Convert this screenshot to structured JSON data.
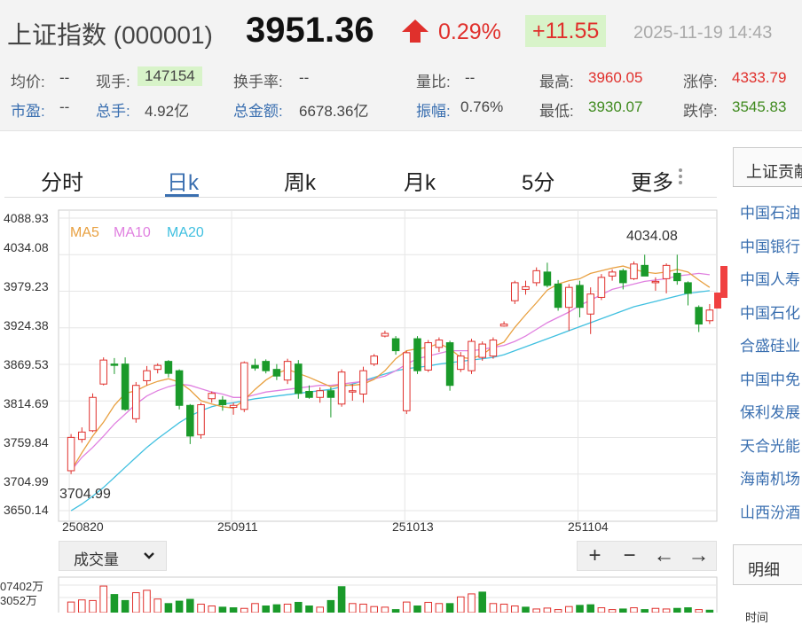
{
  "header": {
    "title": "上证指数 (000001)",
    "price": "3951.36",
    "change_pct": "0.29%",
    "change_abs": "+11.55",
    "datetime": "2025-11-19 14:43",
    "stats": [
      {
        "label": "均价:",
        "value": "--",
        "color": "plain"
      },
      {
        "label": "现手:",
        "value": "147154",
        "color": "hl"
      },
      {
        "label": "换手率:",
        "value": "--",
        "color": "plain"
      },
      {
        "label": "量比:",
        "value": "--",
        "color": "plain"
      },
      {
        "label": "最高:",
        "value": "3960.05",
        "color": "red"
      },
      {
        "label": "涨停:",
        "value": "4333.79",
        "color": "red"
      },
      {
        "label": "市盈:",
        "value": "--",
        "color": "plain"
      },
      {
        "label": "总手:",
        "value": "4.92亿",
        "color": "plain"
      },
      {
        "label": "总金额:",
        "value": "6678.36亿",
        "color": "plain"
      },
      {
        "label": "振幅:",
        "value": "0.76%",
        "color": "plain"
      },
      {
        "label": "最低:",
        "value": "3930.07",
        "color": "green"
      },
      {
        "label": "跌停:",
        "value": "3545.83",
        "color": "green"
      }
    ],
    "colors": {
      "up": "#e0302c",
      "down": "#1a9a2a",
      "accent": "#3a6fb0"
    }
  },
  "tabs": [
    "分时",
    "日k",
    "周k",
    "月k",
    "5分",
    "更多"
  ],
  "active_tab": "日k",
  "chart": {
    "y_ticks": [
      "4088.93",
      "4034.08",
      "3979.23",
      "3924.38",
      "3869.53",
      "3814.69",
      "3759.84",
      "3704.99",
      "3650.14"
    ],
    "x_ticks": [
      "250820",
      "250911",
      "251013",
      "251104"
    ],
    "ma_labels": [
      {
        "name": "MA5",
        "color": "#e8a040"
      },
      {
        "name": "MA10",
        "color": "#e080e0"
      },
      {
        "name": "MA20",
        "color": "#40c0e0"
      }
    ],
    "high_label": "4034.08",
    "low_label": "3704.99"
  },
  "chart_data": {
    "type": "candlestick",
    "ylim": [
      3650.14,
      4088.93
    ],
    "y_ticks": [
      4088.93,
      4034.08,
      3979.23,
      3924.38,
      3869.53,
      3814.69,
      3759.84,
      3704.99,
      3650.14
    ],
    "x_ticks": [
      "250820",
      "250911",
      "251013",
      "251104"
    ],
    "series_names": [
      "MA5",
      "MA10",
      "MA20"
    ],
    "candles": [
      {
        "o": 3710,
        "h": 3765,
        "l": 3705,
        "c": 3760
      },
      {
        "o": 3757,
        "h": 3775,
        "l": 3752,
        "c": 3768
      },
      {
        "o": 3770,
        "h": 3826,
        "l": 3768,
        "c": 3820
      },
      {
        "o": 3840,
        "h": 3880,
        "l": 3838,
        "c": 3876
      },
      {
        "o": 3870,
        "h": 3879,
        "l": 3855,
        "c": 3868
      },
      {
        "o": 3870,
        "h": 3880,
        "l": 3800,
        "c": 3802
      },
      {
        "o": 3788,
        "h": 3843,
        "l": 3782,
        "c": 3838
      },
      {
        "o": 3845,
        "h": 3867,
        "l": 3838,
        "c": 3860
      },
      {
        "o": 3862,
        "h": 3871,
        "l": 3856,
        "c": 3868
      },
      {
        "o": 3874,
        "h": 3876,
        "l": 3850,
        "c": 3856
      },
      {
        "o": 3860,
        "h": 3862,
        "l": 3802,
        "c": 3808
      },
      {
        "o": 3808,
        "h": 3810,
        "l": 3750,
        "c": 3762
      },
      {
        "o": 3764,
        "h": 3812,
        "l": 3758,
        "c": 3809
      },
      {
        "o": 3818,
        "h": 3829,
        "l": 3812,
        "c": 3826
      },
      {
        "o": 3816,
        "h": 3822,
        "l": 3800,
        "c": 3809
      },
      {
        "o": 3805,
        "h": 3812,
        "l": 3794,
        "c": 3808
      },
      {
        "o": 3802,
        "h": 3874,
        "l": 3798,
        "c": 3872
      },
      {
        "o": 3868,
        "h": 3878,
        "l": 3860,
        "c": 3864
      },
      {
        "o": 3874,
        "h": 3877,
        "l": 3856,
        "c": 3860
      },
      {
        "o": 3862,
        "h": 3870,
        "l": 3846,
        "c": 3852
      },
      {
        "o": 3846,
        "h": 3878,
        "l": 3840,
        "c": 3874
      },
      {
        "o": 3870,
        "h": 3876,
        "l": 3818,
        "c": 3826
      },
      {
        "o": 3829,
        "h": 3838,
        "l": 3818,
        "c": 3820
      },
      {
        "o": 3820,
        "h": 3835,
        "l": 3812,
        "c": 3830
      },
      {
        "o": 3830,
        "h": 3835,
        "l": 3790,
        "c": 3820
      },
      {
        "o": 3810,
        "h": 3862,
        "l": 3806,
        "c": 3858
      },
      {
        "o": 3828,
        "h": 3840,
        "l": 3815,
        "c": 3830
      },
      {
        "o": 3825,
        "h": 3866,
        "l": 3812,
        "c": 3860
      },
      {
        "o": 3870,
        "h": 3885,
        "l": 3867,
        "c": 3882
      },
      {
        "o": 3912,
        "h": 3920,
        "l": 3910,
        "c": 3916
      },
      {
        "o": 3908,
        "h": 3912,
        "l": 3884,
        "c": 3890
      },
      {
        "o": 3800,
        "h": 3890,
        "l": 3795,
        "c": 3887
      },
      {
        "o": 3908,
        "h": 3912,
        "l": 3855,
        "c": 3860
      },
      {
        "o": 3861,
        "h": 3906,
        "l": 3858,
        "c": 3902
      },
      {
        "o": 3895,
        "h": 3910,
        "l": 3888,
        "c": 3906
      },
      {
        "o": 3902,
        "h": 3905,
        "l": 3830,
        "c": 3838
      },
      {
        "o": 3862,
        "h": 3888,
        "l": 3858,
        "c": 3882
      },
      {
        "o": 3860,
        "h": 3908,
        "l": 3855,
        "c": 3904
      },
      {
        "o": 3880,
        "h": 3904,
        "l": 3875,
        "c": 3900
      },
      {
        "o": 3882,
        "h": 3910,
        "l": 3878,
        "c": 3906
      },
      {
        "o": 3927,
        "h": 3934,
        "l": 3926,
        "c": 3930
      },
      {
        "o": 3965,
        "h": 3995,
        "l": 3960,
        "c": 3992
      },
      {
        "o": 3982,
        "h": 3995,
        "l": 3974,
        "c": 3986
      },
      {
        "o": 3992,
        "h": 4015,
        "l": 3987,
        "c": 4010
      },
      {
        "o": 4008,
        "h": 4022,
        "l": 3985,
        "c": 3988
      },
      {
        "o": 3990,
        "h": 3996,
        "l": 3950,
        "c": 3955
      },
      {
        "o": 3955,
        "h": 3990,
        "l": 3920,
        "c": 3985
      },
      {
        "o": 3988,
        "h": 3995,
        "l": 3940,
        "c": 3955
      },
      {
        "o": 3945,
        "h": 3985,
        "l": 3915,
        "c": 3975
      },
      {
        "o": 3970,
        "h": 4005,
        "l": 3966,
        "c": 4000
      },
      {
        "o": 4002,
        "h": 4012,
        "l": 3995,
        "c": 4008
      },
      {
        "o": 4010,
        "h": 4013,
        "l": 3982,
        "c": 3992
      },
      {
        "o": 3998,
        "h": 4024,
        "l": 3996,
        "c": 4020
      },
      {
        "o": 4018,
        "h": 4034,
        "l": 4002,
        "c": 4002
      },
      {
        "o": 3992,
        "h": 4000,
        "l": 3980,
        "c": 3994
      },
      {
        "o": 3998,
        "h": 4021,
        "l": 3976,
        "c": 4018
      },
      {
        "o": 4006,
        "h": 4034,
        "l": 3989,
        "c": 3995
      },
      {
        "o": 3992,
        "h": 3994,
        "l": 3958,
        "c": 3976
      },
      {
        "o": 3955,
        "h": 3958,
        "l": 3918,
        "c": 3930
      },
      {
        "o": 3935,
        "h": 3960,
        "l": 3930,
        "c": 3951
      }
    ],
    "ma5": [
      3710,
      3737,
      3762,
      3783,
      3808,
      3826,
      3830,
      3838,
      3844,
      3848,
      3843,
      3831,
      3815,
      3810,
      3806,
      3804,
      3816,
      3832,
      3846,
      3856,
      3862,
      3856,
      3850,
      3843,
      3836,
      3839,
      3838,
      3840,
      3847,
      3860,
      3878,
      3890,
      3893,
      3895,
      3901,
      3893,
      3880,
      3878,
      3884,
      3896,
      3903,
      3925,
      3944,
      3962,
      3981,
      3990,
      3995,
      3998,
      4006,
      4010,
      4014,
      4017,
      4012,
      4008,
      4006,
      4008,
      4012,
      4008,
      3996,
      3985
    ],
    "ma10": [
      3710,
      3730,
      3745,
      3762,
      3780,
      3795,
      3810,
      3822,
      3830,
      3836,
      3840,
      3838,
      3833,
      3828,
      3825,
      3820,
      3820,
      3824,
      3828,
      3830,
      3832,
      3834,
      3836,
      3838,
      3838,
      3840,
      3842,
      3844,
      3848,
      3852,
      3860,
      3870,
      3878,
      3882,
      3886,
      3890,
      3890,
      3890,
      3892,
      3895,
      3898,
      3904,
      3912,
      3922,
      3932,
      3940,
      3948,
      3958,
      3966,
      3974,
      3982,
      3986,
      3990,
      3994,
      3996,
      3998,
      4002,
      4004,
      4006,
      4004
    ],
    "ma20": [
      3650,
      3660,
      3672,
      3685,
      3700,
      3715,
      3730,
      3745,
      3758,
      3770,
      3782,
      3792,
      3800,
      3806,
      3810,
      3812,
      3815,
      3818,
      3820,
      3822,
      3824,
      3826,
      3828,
      3830,
      3832,
      3836,
      3840,
      3845,
      3850,
      3855,
      3860,
      3863,
      3865,
      3867,
      3870,
      3872,
      3874,
      3876,
      3878,
      3880,
      3884,
      3890,
      3896,
      3902,
      3908,
      3914,
      3920,
      3926,
      3932,
      3938,
      3944,
      3950,
      3956,
      3960,
      3964,
      3968,
      3972,
      3976,
      3978,
      3980
    ],
    "volume": [
      {
        "v": 0.35,
        "up": true
      },
      {
        "v": 0.42,
        "up": true
      },
      {
        "v": 0.4,
        "up": true
      },
      {
        "v": 0.88,
        "up": true
      },
      {
        "v": 0.6,
        "up": false
      },
      {
        "v": 0.4,
        "up": false
      },
      {
        "v": 0.66,
        "up": true
      },
      {
        "v": 0.74,
        "up": true
      },
      {
        "v": 0.45,
        "up": true
      },
      {
        "v": 0.3,
        "up": false
      },
      {
        "v": 0.38,
        "up": false
      },
      {
        "v": 0.44,
        "up": false
      },
      {
        "v": 0.28,
        "up": true
      },
      {
        "v": 0.22,
        "up": true
      },
      {
        "v": 0.18,
        "up": false
      },
      {
        "v": 0.16,
        "up": false
      },
      {
        "v": 0.14,
        "up": true
      },
      {
        "v": 0.3,
        "up": true
      },
      {
        "v": 0.22,
        "up": false
      },
      {
        "v": 0.26,
        "up": false
      },
      {
        "v": 0.28,
        "up": true
      },
      {
        "v": 0.34,
        "up": false
      },
      {
        "v": 0.22,
        "up": false
      },
      {
        "v": 0.18,
        "up": true
      },
      {
        "v": 0.4,
        "up": false
      },
      {
        "v": 0.86,
        "up": false
      },
      {
        "v": 0.3,
        "up": true
      },
      {
        "v": 0.28,
        "up": true
      },
      {
        "v": 0.2,
        "up": true
      },
      {
        "v": 0.18,
        "up": true
      },
      {
        "v": 0.1,
        "up": false
      },
      {
        "v": 0.35,
        "up": true
      },
      {
        "v": 0.22,
        "up": false
      },
      {
        "v": 0.34,
        "up": true
      },
      {
        "v": 0.3,
        "up": true
      },
      {
        "v": 0.3,
        "up": false
      },
      {
        "v": 0.52,
        "up": true
      },
      {
        "v": 0.62,
        "up": true
      },
      {
        "v": 0.68,
        "up": false
      },
      {
        "v": 0.3,
        "up": true
      },
      {
        "v": 0.28,
        "up": true
      },
      {
        "v": 0.22,
        "up": true
      },
      {
        "v": 0.18,
        "up": false
      },
      {
        "v": 0.12,
        "up": true
      },
      {
        "v": 0.15,
        "up": true
      },
      {
        "v": 0.1,
        "up": true
      },
      {
        "v": 0.2,
        "up": true
      },
      {
        "v": 0.24,
        "up": false
      },
      {
        "v": 0.26,
        "up": false
      },
      {
        "v": 0.16,
        "up": true
      },
      {
        "v": 0.1,
        "up": true
      },
      {
        "v": 0.12,
        "up": false
      },
      {
        "v": 0.16,
        "up": true
      },
      {
        "v": 0.1,
        "up": false
      },
      {
        "v": 0.14,
        "up": true
      },
      {
        "v": 0.12,
        "up": true
      },
      {
        "v": 0.14,
        "up": false
      },
      {
        "v": 0.16,
        "up": false
      },
      {
        "v": 0.1,
        "up": true
      },
      {
        "v": 0.08,
        "up": false
      }
    ]
  },
  "volume_panel": {
    "selector_label": "成交量",
    "labels": [
      "07402万",
      "3052万"
    ],
    "controls": [
      "+",
      "−",
      "←",
      "→"
    ]
  },
  "sidebar": {
    "heading": "上证贡献",
    "items": [
      "中国石油",
      "中国银行",
      "中国人寿",
      "中国石化",
      "合盛硅业",
      "中国中免",
      "保利发展",
      "天合光能",
      "海南机场",
      "山西汾酒"
    ],
    "detail_tab": "明细",
    "bottom_text": "时间"
  }
}
